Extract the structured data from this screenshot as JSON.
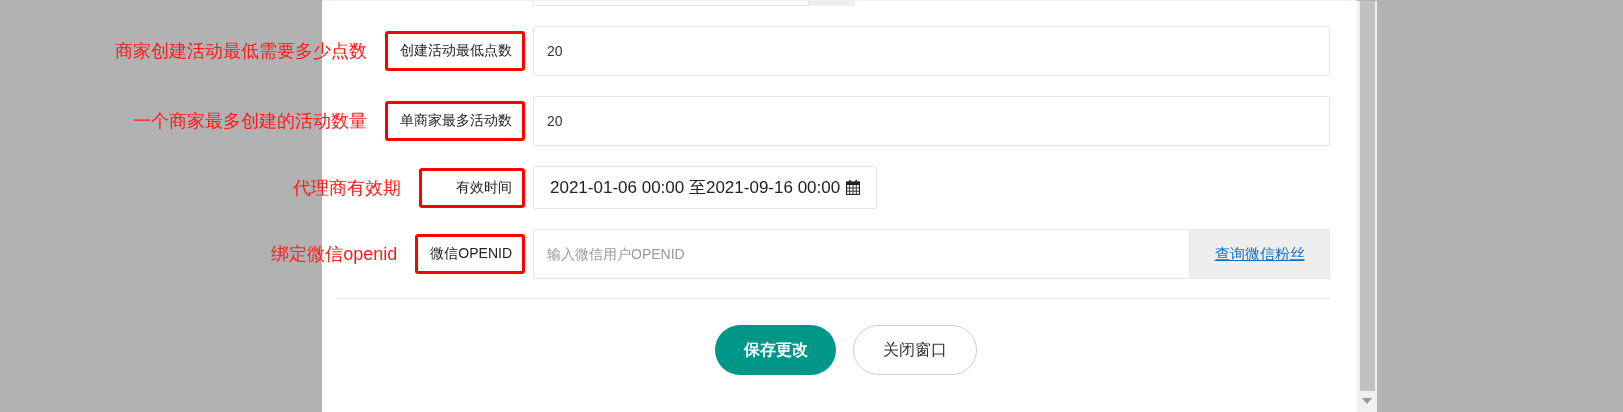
{
  "form": {
    "rows": [
      {
        "annotation": "商家创建活动最低需要多少点数",
        "label": "创建活动最低点数",
        "kind": "text",
        "value": "20"
      },
      {
        "annotation": "一个商家最多创建的活动数量",
        "label": "单商家最多活动数",
        "kind": "text",
        "value": "20"
      },
      {
        "annotation": "代理商有效期",
        "label": "有效时间",
        "kind": "date",
        "value": "2021-01-06 00:00 至2021-09-16 00:00"
      },
      {
        "annotation": "绑定微信openid",
        "label": "微信OPENID",
        "kind": "search",
        "placeholder": "输入微信用户OPENID",
        "button": "查询微信粉丝"
      }
    ]
  },
  "buttons": [
    {
      "label": "保存更改",
      "kind": "primary"
    },
    {
      "label": "关闭窗口",
      "kind": "secondary"
    }
  ]
}
